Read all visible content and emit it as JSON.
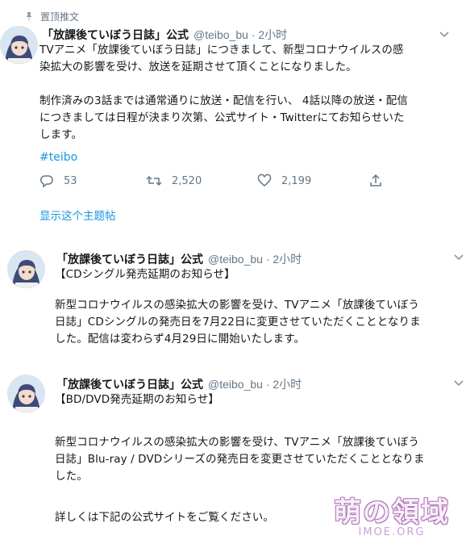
{
  "pinned_label": "置顶推文",
  "tweets": [
    {
      "name": "「放課後ていぼう日誌」公式",
      "handle": "@teibo_bu · 2小时",
      "lines": [
        "TVアニメ「放課後ていぼう日誌」につきまして、新型コロナウイルスの感",
        "染拡大の影響を受け、放送を延期させて頂くことになりました。",
        "",
        "制作済みの3話までは通常通りに放送・配信を行い、 4話以降の放送・配信",
        "につきましては日程が決まり次第、公式サイト・Twitterにてお知らせいた",
        "します。"
      ],
      "hashtag": "#teibo",
      "replies": "53",
      "retweets": "2,520",
      "likes": "2,199",
      "show_thread": "显示这个主题帖"
    },
    {
      "name": "「放課後ていぼう日誌」公式",
      "handle": "@teibo_bu · 2小时",
      "lines": [
        "【CDシングル発売延期のお知らせ】",
        "",
        "新型コロナウイルスの感染拡大の影響を受け、TVアニメ「放課後ていぼう",
        "日誌」CDシングルの発売日を7月22日に変更させていただくこととなりま",
        "した。配信は変わらず4月29日に開始いたします。"
      ]
    },
    {
      "name": "「放課後ていぼう日誌」公式",
      "handle": "@teibo_bu · 2小时",
      "lines": [
        "【BD/DVD発売延期のお知らせ】",
        "",
        "",
        "新型コロナウイルスの感染拡大の影響を受け、TVアニメ「放課後ていぼう",
        "日誌」Blu-ray / DVDシリーズの発売日を変更させていただくこととなりま",
        "した。",
        "",
        "",
        "詳しくは下記の公式サイトをご覧ください。"
      ]
    }
  ],
  "watermark": {
    "main": "萌の領域",
    "sub": "IMOE.ORG"
  },
  "colors": {
    "link": "#1b95e0",
    "muted": "#657786",
    "text": "#14171a"
  }
}
